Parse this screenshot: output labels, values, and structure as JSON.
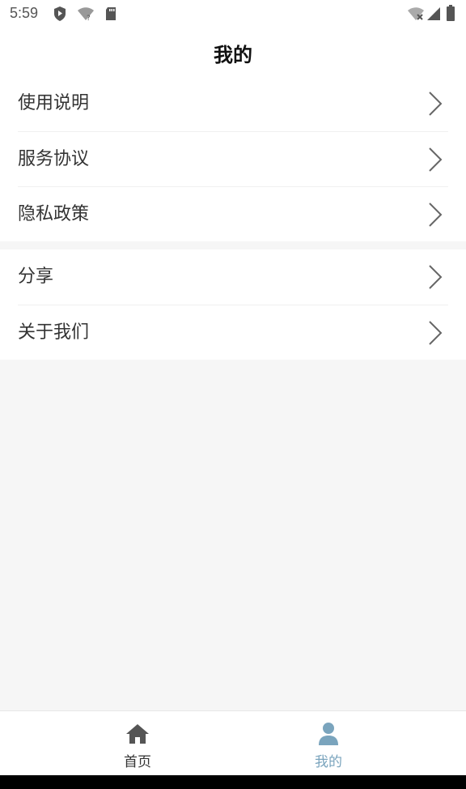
{
  "status_bar": {
    "time": "5:59"
  },
  "header": {
    "title": "我的"
  },
  "menu": {
    "group1": [
      {
        "label": "使用说明"
      },
      {
        "label": "服务协议"
      },
      {
        "label": "隐私政策"
      }
    ],
    "group2": [
      {
        "label": "分享"
      },
      {
        "label": "关于我们"
      }
    ]
  },
  "tabbar": {
    "tabs": [
      {
        "label": "首页",
        "icon": "home-icon",
        "active": false
      },
      {
        "label": "我的",
        "icon": "user-icon",
        "active": true
      }
    ],
    "active_color": "#7aa4bd",
    "inactive_color": "#555555"
  }
}
